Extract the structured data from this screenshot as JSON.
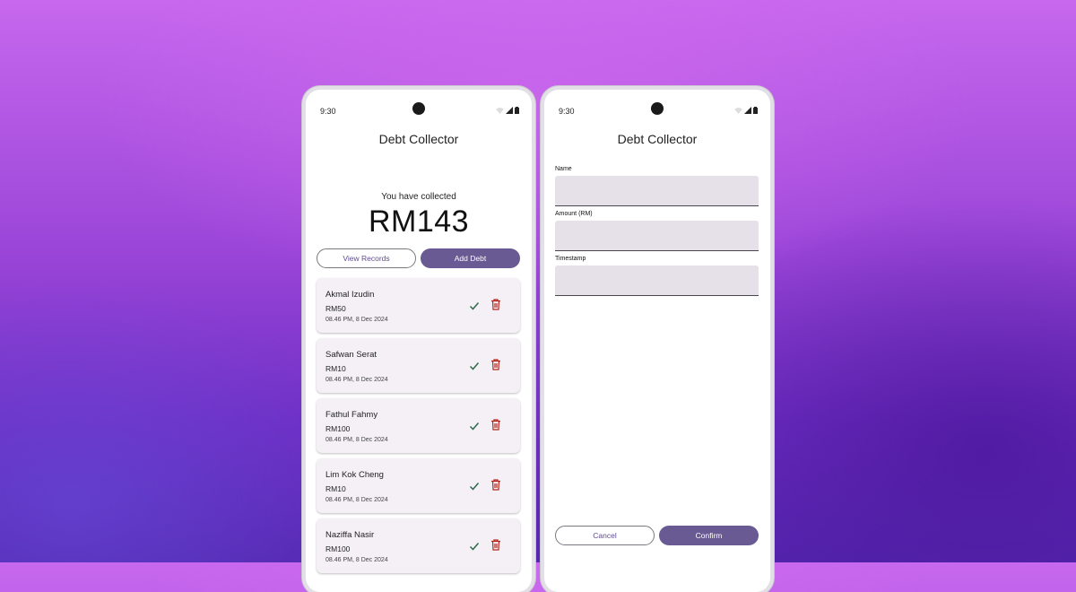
{
  "status_bar": {
    "time": "9:30"
  },
  "app": {
    "title": "Debt Collector"
  },
  "summary": {
    "label": "You have collected",
    "amount": "RM143"
  },
  "actions": {
    "view_records": "View Records",
    "add_debt": "Add Debt"
  },
  "debts": [
    {
      "name": "Akmal Izudin",
      "amount": "RM50",
      "timestamp": "08.46 PM, 8 Dec 2024"
    },
    {
      "name": "Safwan Serat",
      "amount": "RM10",
      "timestamp": "08.46 PM, 8 Dec 2024"
    },
    {
      "name": "Fathul Fahmy",
      "amount": "RM100",
      "timestamp": "08.46 PM, 8 Dec 2024"
    },
    {
      "name": "Lim Kok Cheng",
      "amount": "RM10",
      "timestamp": "08.46 PM, 8 Dec 2024"
    },
    {
      "name": "Naziffa Nasir",
      "amount": "RM100",
      "timestamp": "08.46 PM, 8 Dec 2024"
    }
  ],
  "form": {
    "fields": [
      {
        "label": "Name",
        "value": ""
      },
      {
        "label": "Amount (RM)",
        "value": ""
      },
      {
        "label": "Timestamp",
        "value": ""
      }
    ],
    "cancel_label": "Cancel",
    "confirm_label": "Confirm"
  },
  "icons": {
    "check": "check-icon",
    "delete": "trash-icon",
    "wifi": "wifi-icon",
    "signal": "signal-icon",
    "battery": "battery-icon"
  },
  "colors": {
    "primary": "#6a5a93",
    "check": "#2e6b4a",
    "delete": "#b3261e",
    "card_bg": "#f4f0f6",
    "field_bg": "#e6e0e9"
  }
}
